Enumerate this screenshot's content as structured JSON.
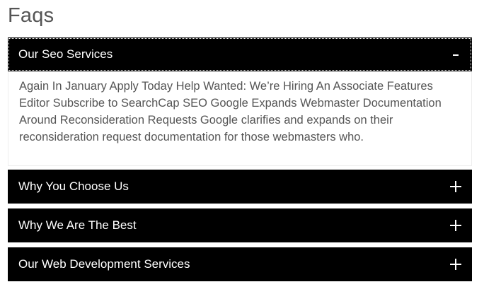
{
  "page": {
    "title": "Faqs"
  },
  "faqs": [
    {
      "title": "Our Seo Services",
      "expanded": true,
      "toggle_icon": "minus-icon",
      "content": "Again In January Apply Today Help Wanted: We’re Hiring An Associate Features Editor Subscribe to SearchCap SEO Google Expands Webmaster Documentation Around Reconsideration Requests Google clarifies and expands on their reconsideration request documentation for those webmasters who."
    },
    {
      "title": "Why You Choose Us",
      "expanded": false,
      "toggle_icon": "plus-icon"
    },
    {
      "title": "Why We Are The Best",
      "expanded": false,
      "toggle_icon": "plus-icon"
    },
    {
      "title": "Our Web Development Services",
      "expanded": false,
      "toggle_icon": "plus-icon"
    }
  ],
  "colors": {
    "header_bg": "#000000",
    "header_text": "#ffffff",
    "body_text": "#555555",
    "title_text": "#555555"
  }
}
